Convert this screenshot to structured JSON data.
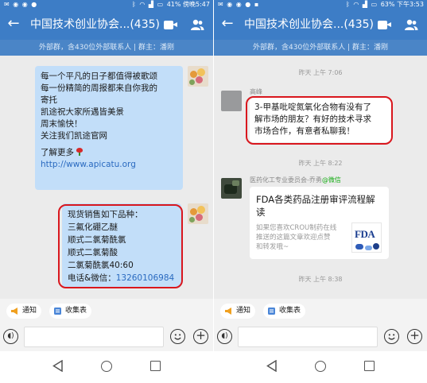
{
  "left": {
    "status": {
      "left_icons": "✉ ◉ ◉ ●",
      "right_text": "41%  傍晚5:47",
      "battery_percent": 41
    },
    "header": {
      "title": "中国技术创业协会...(435)",
      "subtitle": "外部群，含430位外部联系人 | 群主：潘刚"
    },
    "messages": [
      {
        "type": "text",
        "lines": [
          "每一个平凡的日子都值得被歌颂",
          "每一份精简的周报都来自你我的",
          "寄托",
          "凯途祝大家所遇皆美景",
          "周末愉快！",
          "关注我们凯途官网"
        ],
        "learn_more": "了解更多",
        "link": "http://www.apicatu.org"
      },
      {
        "type": "text",
        "lines": [
          "现货销售如下品种：",
          "三氟化硼乙醚",
          "顺式二氯菊酰氯",
          "顺式二氯菊酸",
          "二氯菊酰氯40:60"
        ],
        "contact_label": "电话&微信：",
        "phone": "13260106984"
      }
    ],
    "quick_actions": [
      "通知",
      "收集表"
    ]
  },
  "right": {
    "status": {
      "left_icons": "✉ ◉ ◉ ● ▪",
      "right_text": "63%  下午3:53",
      "battery_percent": 63
    },
    "header": {
      "title": "中国技术创业协会...(435)",
      "subtitle": "外部群，含430位外部联系人 | 群主：潘刚"
    },
    "timestamps": [
      "昨天 上午 7:06",
      "昨天 上午 8:22",
      "昨天 上午 8:38"
    ],
    "messages": [
      {
        "type": "text",
        "sender": "高峰",
        "lines": [
          "3-甲基吡啶氮氧化合物有没有了",
          "解市场的朋友？有好的技术寻求",
          "市场合作，有意者私聊我！"
        ]
      },
      {
        "type": "card",
        "sender": "医药化工专业委员会-乔勇",
        "sender_badge": "@微信",
        "title_lines": [
          "FDA各类药品注册审评流程解",
          "读"
        ],
        "desc_lines": [
          "如果您喜欢CROU制药在线",
          "推送的这篇文章欢迎点赞",
          "和转发哦~"
        ],
        "thumb_text": "FDA"
      }
    ],
    "quick_actions": [
      "通知",
      "收集表"
    ]
  },
  "colors": {
    "header_blue": "#3d7dc6",
    "bubble_blue": "#c2def9",
    "highlight_red": "#d9161d",
    "link_blue": "#2a6ac0"
  },
  "icons": {
    "back": "arrow-left-icon",
    "video": "video-call-icon",
    "people": "group-members-icon",
    "voice": "voice-input-icon",
    "emoji": "emoji-icon",
    "plus": "plus-icon",
    "notice": "megaphone-icon",
    "form": "collect-form-icon"
  }
}
